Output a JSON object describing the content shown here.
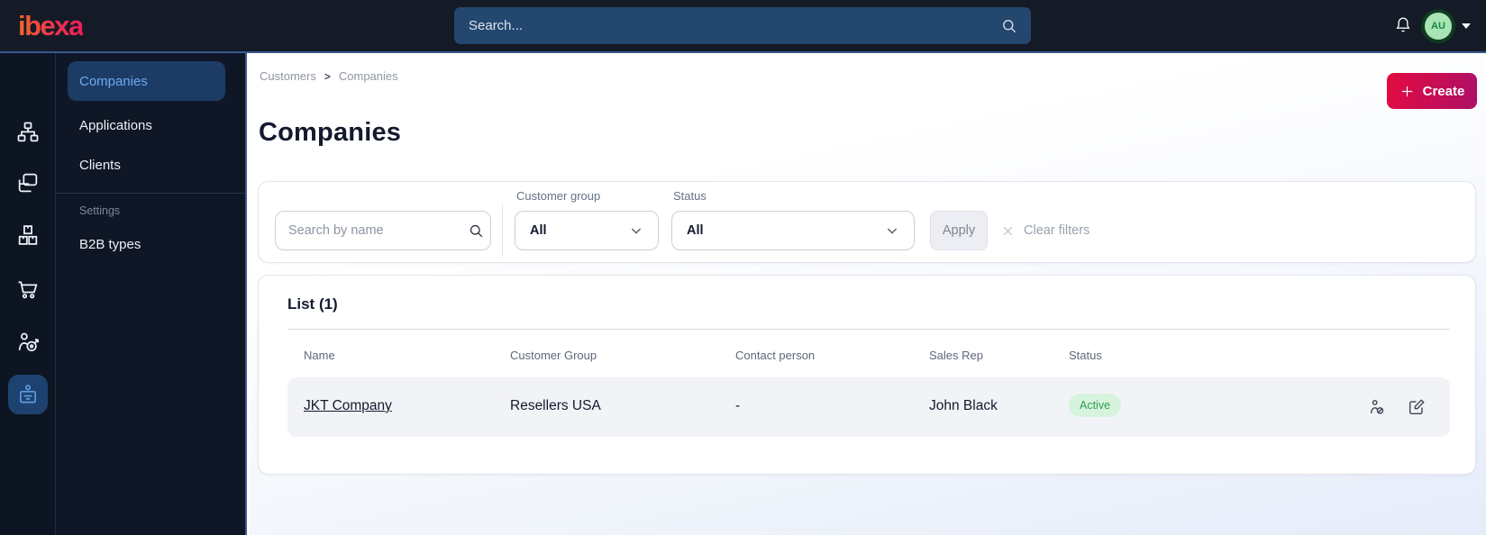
{
  "topbar": {
    "logo_text": "ibexa",
    "search_placeholder": "Search...",
    "avatar_initials": "AU",
    "icons": [
      "search-icon",
      "notification-bell-icon",
      "caret-down-icon"
    ]
  },
  "sidebar": {
    "rail_icons": [
      "content-tree-icon",
      "pages-icon",
      "products-boxes-icon",
      "cart-icon",
      "customer-target-icon",
      "company-badge-icon"
    ],
    "active_rail_icon": "company-badge-icon",
    "menu": {
      "items": [
        {
          "label": "Companies",
          "active": true
        },
        {
          "label": "Applications",
          "active": false
        },
        {
          "label": "Clients",
          "active": false
        }
      ],
      "section_label": "Settings",
      "section_items": [
        {
          "label": "B2B types",
          "active": false
        }
      ]
    }
  },
  "breadcrumb": {
    "items": [
      "Customers",
      "Companies"
    ],
    "separator": ">"
  },
  "page": {
    "title": "Companies",
    "create_label": "Create"
  },
  "filters": {
    "search_placeholder": "Search by name",
    "customer_group": {
      "label": "Customer group",
      "value": "All"
    },
    "status": {
      "label": "Status",
      "value": "All"
    },
    "apply_label": "Apply",
    "clear_label": "Clear filters"
  },
  "list": {
    "title": "List (1)",
    "columns": [
      "Name",
      "Customer Group",
      "Contact person",
      "Sales Rep",
      "Status"
    ],
    "rows": [
      {
        "name": "JKT Company",
        "customer_group": "Resellers USA",
        "contact_person": "-",
        "sales_rep": "John Black",
        "status": "Active",
        "actions": [
          "deactivate-user-icon",
          "edit-icon"
        ]
      }
    ]
  },
  "colors": {
    "topbar_bg": "#151a27",
    "sidebar_bg": "#0d1422",
    "accent_blue_border": "#3a5a8d",
    "sidebar_active_bg": "#1c3c66",
    "sidebar_active_text": "#6fa9ef",
    "create_gradient_start": "#e30b41",
    "create_gradient_end": "#ad1066",
    "logo_gradient_start": "#f2672a",
    "logo_gradient_end": "#e91e56",
    "status_badge_bg": "#d6f3de",
    "status_badge_text": "#2e9e50",
    "avatar_bg": "#a9e4b4",
    "avatar_text": "#1a8744"
  }
}
